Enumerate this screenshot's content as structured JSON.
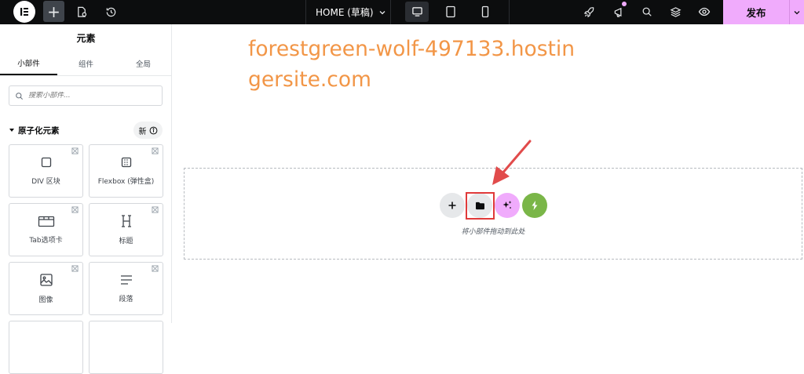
{
  "topbar": {
    "page_title": "HOME (草稿)",
    "publish_label": "发布",
    "accent_color": "#f0abfc",
    "icons": [
      "elementor-logo-icon",
      "add-element-icon",
      "page-settings-icon",
      "history-icon",
      "desktop-icon",
      "tablet-icon",
      "mobile-icon",
      "rocket-icon",
      "notifications-icon",
      "search-icon",
      "structure-icon",
      "preview-icon",
      "chevron-down-icon"
    ]
  },
  "sidebar": {
    "title": "元素",
    "tabs": [
      "小部件",
      "组件",
      "全局"
    ],
    "active_tab": "小部件",
    "search_placeholder": "搜索小部件...",
    "category": {
      "label": "原子化元素",
      "badge": "新"
    },
    "widgets": [
      {
        "label": "DIV 区块",
        "icon": "div-block-icon"
      },
      {
        "label": "Flexbox (弹性盒)",
        "icon": "flexbox-icon"
      },
      {
        "label": "Tab选项卡",
        "icon": "tabs-icon"
      },
      {
        "label": "标题",
        "icon": "heading-icon"
      },
      {
        "label": "图像",
        "icon": "image-icon"
      },
      {
        "label": "段落",
        "icon": "paragraph-icon"
      }
    ]
  },
  "canvas": {
    "site_title": "forestgreen-wolf-497133.hostingersite.com",
    "site_title_color": "#f29647",
    "drop_label": "将小部件拖动到此处",
    "actions": [
      "add-section-icon",
      "template-library-icon",
      "ai-icon",
      "kit-icon"
    ],
    "highlight_color": "#e03a3a"
  }
}
